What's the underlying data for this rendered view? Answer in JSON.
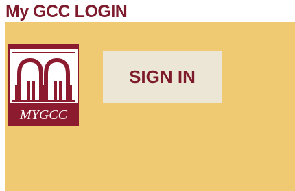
{
  "page": {
    "title": "My GCC LOGIN"
  },
  "logo": {
    "text_prefix": "MY",
    "text_suffix": "GCC",
    "color": "#8c1b2f"
  },
  "signin": {
    "label": "SIGN IN"
  },
  "colors": {
    "title": "#7d1a2c",
    "panel": "#f0ca72",
    "button_bg": "#ece6d6",
    "button_text": "#7d1a2c"
  }
}
